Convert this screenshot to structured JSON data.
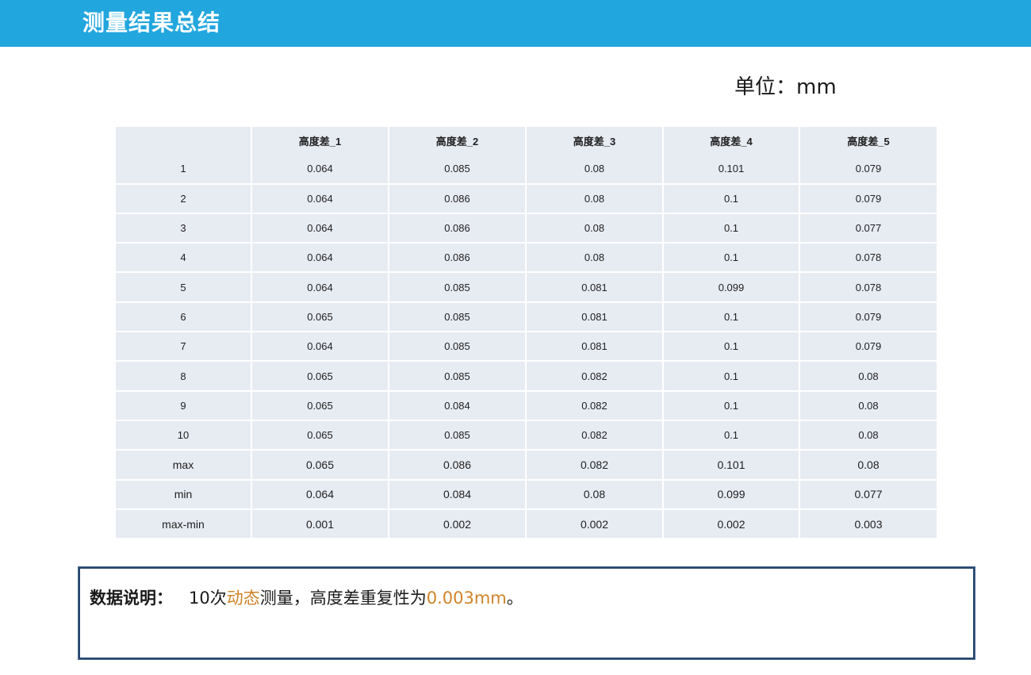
{
  "header": {
    "title": "测量结果总结",
    "bg_color": "#22a6de"
  },
  "unit_label": "单位：mm",
  "table": {
    "columns": [
      "",
      "高度差_1",
      "高度差_2",
      "高度差_3",
      "高度差_4",
      "高度差_5"
    ],
    "rows": [
      [
        "1",
        "0.064",
        "0.085",
        "0.08",
        "0.101",
        "0.079"
      ],
      [
        "2",
        "0.064",
        "0.086",
        "0.08",
        "0.1",
        "0.079"
      ],
      [
        "3",
        "0.064",
        "0.086",
        "0.08",
        "0.1",
        "0.077"
      ],
      [
        "4",
        "0.064",
        "0.086",
        "0.08",
        "0.1",
        "0.078"
      ],
      [
        "5",
        "0.064",
        "0.085",
        "0.081",
        "0.099",
        "0.078"
      ],
      [
        "6",
        "0.065",
        "0.085",
        "0.081",
        "0.1",
        "0.079"
      ],
      [
        "7",
        "0.064",
        "0.085",
        "0.081",
        "0.1",
        "0.079"
      ],
      [
        "8",
        "0.065",
        "0.085",
        "0.082",
        "0.1",
        "0.08"
      ],
      [
        "9",
        "0.065",
        "0.084",
        "0.082",
        "0.1",
        "0.08"
      ],
      [
        "10",
        "0.065",
        "0.085",
        "0.082",
        "0.1",
        "0.08"
      ]
    ],
    "stat_rows": [
      [
        "max",
        "0.065",
        "0.086",
        "0.082",
        "0.101",
        "0.08"
      ],
      [
        "min",
        "0.064",
        "0.084",
        "0.08",
        "0.099",
        "0.077"
      ],
      [
        "max-min",
        "0.001",
        "0.002",
        "0.002",
        "0.002",
        "0.003"
      ]
    ]
  },
  "note": {
    "label": "数据说明：",
    "text_1": "10次",
    "highlight_1": "动态",
    "text_2": "测量，高度差重复性为",
    "highlight_2": "0.003mm",
    "text_3": "。",
    "highlight_color": "#d0832a"
  }
}
